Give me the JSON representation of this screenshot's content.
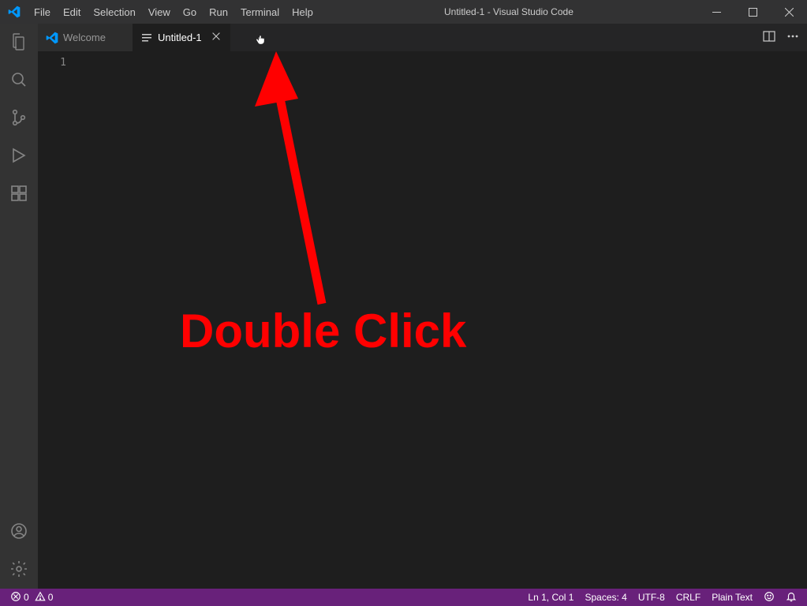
{
  "title": "Untitled-1 - Visual Studio Code",
  "menubar": [
    "File",
    "Edit",
    "Selection",
    "View",
    "Go",
    "Run",
    "Terminal",
    "Help"
  ],
  "tabs": [
    {
      "label": "Welcome",
      "active": false
    },
    {
      "label": "Untitled-1",
      "active": true
    }
  ],
  "editor": {
    "line_numbers": [
      "1"
    ]
  },
  "annotation": {
    "text": "Double Click"
  },
  "statusbar": {
    "errors": "0",
    "warnings": "0",
    "cursor": "Ln 1, Col 1",
    "spaces": "Spaces: 4",
    "encoding": "UTF-8",
    "eol": "CRLF",
    "language": "Plain Text"
  }
}
